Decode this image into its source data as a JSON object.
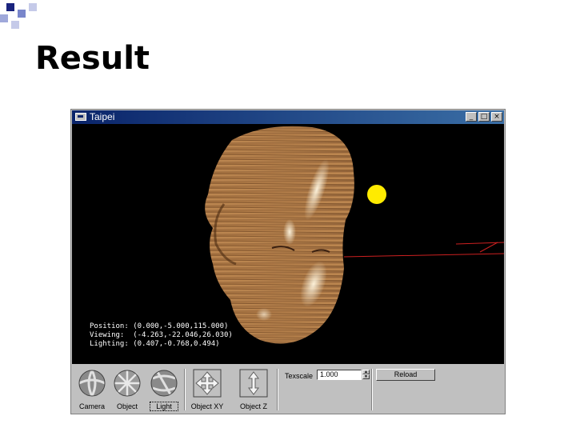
{
  "slide": {
    "title": "Result"
  },
  "window": {
    "title": "Taipei",
    "buttons": {
      "minimize": "_",
      "maximize": "□",
      "close": "×"
    }
  },
  "hud": {
    "position_label": "Position:",
    "position_value": "(0.000,-5.000,115.000)",
    "viewing_label": "Viewing:",
    "viewing_value": "(-4.263,-22.046,26.030)",
    "lighting_label": "Lighting:",
    "lighting_value": "(0.407,-0.768,0.494)"
  },
  "controls": {
    "tools": [
      {
        "label": "Camera",
        "icon": "camera-sphere-icon"
      },
      {
        "label": "Object",
        "icon": "object-sphere-icon"
      },
      {
        "label": "Light",
        "icon": "light-sphere-icon",
        "selected": true
      },
      {
        "label": "Object XY",
        "icon": "move-xy-icon"
      },
      {
        "label": "Object Z",
        "icon": "move-z-icon"
      }
    ],
    "texscale_label": "Texscale",
    "texscale_value": "1.000",
    "reload_label": "Reload"
  },
  "colors": {
    "titlebar": "#0a246a",
    "viewport_bg": "#000000",
    "light_source": "#ffeb00",
    "axis_line": "#cc2020",
    "wood": "#b07a45"
  }
}
